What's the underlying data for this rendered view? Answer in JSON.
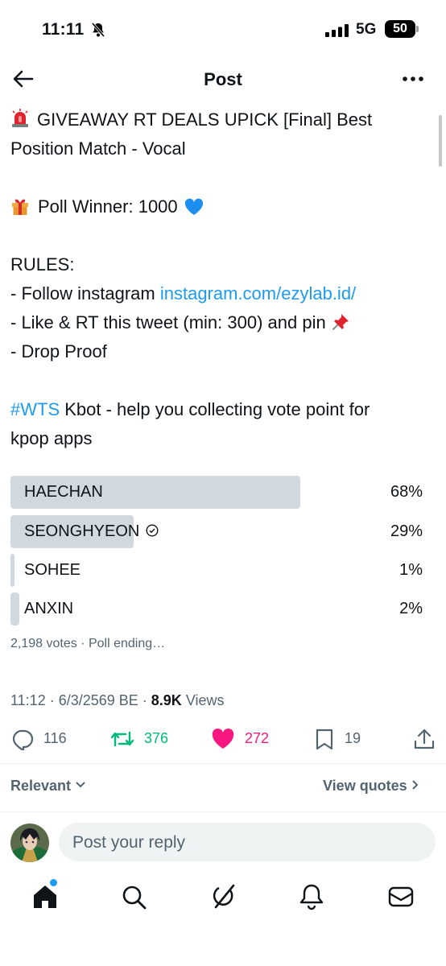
{
  "status_bar": {
    "time": "11:11",
    "network": "5G",
    "battery": "50"
  },
  "header": {
    "title": "Post"
  },
  "post": {
    "line1": "GIVEAWAY RT DEALS UPICK [Final] Best",
    "line2": "Position Match - Vocal",
    "poll_winner": "Poll Winner: 1000",
    "rules_title": "RULES:",
    "rule1_prefix": "- Follow instagram ",
    "rule1_link": "instagram.com/ezylab.id/",
    "rule2": "- Like & RT this tweet (min: 300) and pin",
    "rule3": "- Drop Proof",
    "hashtag": "#WTS",
    "line_wts": " Kbot - help you collecting vote point for",
    "line_wts2": "kpop apps"
  },
  "poll": {
    "options": [
      {
        "label": "HAECHAN",
        "percent_text": "68%",
        "fraction": 0.68
      },
      {
        "label": "SEONGHYEON",
        "percent_text": "29%",
        "fraction": 0.29
      },
      {
        "label": "SOHEE",
        "percent_text": "1%",
        "fraction": 0.01
      },
      {
        "label": "ANXIN",
        "percent_text": "2%",
        "fraction": 0.02
      }
    ],
    "meta": "2,198 votes · Poll ending…"
  },
  "meta": {
    "time_date": "11:12 · 6/3/2569 BE · ",
    "views_count": "8.9K",
    "views_label": " Views"
  },
  "actions": {
    "replies": "116",
    "reposts": "376",
    "likes": "272",
    "bookmarks": "19"
  },
  "sort": {
    "relevant": "Relevant",
    "view_quotes": "View quotes"
  },
  "reply": {
    "placeholder": "Post your reply"
  },
  "colors": {
    "link": "#1d9bf0",
    "repost": "#00ba7c",
    "like": "#f91880",
    "poll_bar": "#cfd9de",
    "muted": "#536471"
  },
  "icons": [
    "back-arrow-icon",
    "more-icon",
    "siren-emoji",
    "gift-emoji",
    "blue-heart-emoji",
    "pushpin-emoji",
    "verified-check-icon",
    "reply-icon",
    "repost-icon",
    "like-icon",
    "bookmark-icon",
    "share-icon",
    "home-icon",
    "search-icon",
    "grok-icon",
    "notifications-icon",
    "messages-icon"
  ]
}
